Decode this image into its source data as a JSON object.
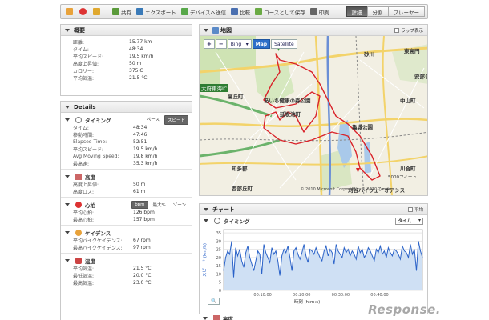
{
  "toolbar": {
    "share": "共有",
    "export": "エクスポート",
    "send_device": "デバイスへ送信",
    "compare": "比較",
    "save_course": "コースとして保存",
    "print": "印刷",
    "views": [
      "詳細",
      "分割",
      "プレーヤー"
    ],
    "active_view": "詳細"
  },
  "overview": {
    "title": "概要",
    "rows": [
      {
        "k": "距離:",
        "v": "15.77 km"
      },
      {
        "k": "タイム:",
        "v": "48:34"
      },
      {
        "k": "平均スピード:",
        "v": "19.5 km/h"
      },
      {
        "k": "高度上昇値:",
        "v": "50 m"
      },
      {
        "k": "カロリー:",
        "v": "375 C"
      },
      {
        "k": "平均気温:",
        "v": "21.5 °C"
      }
    ]
  },
  "details": {
    "title": "Details",
    "timing": {
      "title": "タイミング",
      "pills": [
        "ペース",
        "スピード"
      ],
      "rows": [
        {
          "k": "タイム:",
          "v": "48:34"
        },
        {
          "k": "移動時間:",
          "v": "47:46"
        },
        {
          "k": "Elapsed Time:",
          "v": "52:51"
        },
        {
          "k": "平均スピード:",
          "v": "19.5 km/h"
        },
        {
          "k": "Avg Moving Speed:",
          "v": "19.8 km/h"
        },
        {
          "k": "最高速:",
          "v": "35.3 km/h"
        }
      ]
    },
    "elevation": {
      "title": "高度",
      "rows": [
        {
          "k": "高度上昇値:",
          "v": "50 m"
        },
        {
          "k": "高度ロス:",
          "v": "61 m"
        }
      ]
    },
    "heart": {
      "title": "心拍",
      "pills": [
        "bpm",
        "最大%",
        "ゾーン"
      ],
      "rows": [
        {
          "k": "平均心拍:",
          "v": "126 bpm"
        },
        {
          "k": "最高心拍:",
          "v": "157 bpm"
        }
      ]
    },
    "cadence": {
      "title": "ケイデンス",
      "rows": [
        {
          "k": "平均バイクケイデンス:",
          "v": "67 rpm"
        },
        {
          "k": "最高バイクケイデンス:",
          "v": "97 rpm"
        }
      ]
    },
    "temperature": {
      "title": "温度",
      "rows": [
        {
          "k": "平均気温:",
          "v": "21.5 °C"
        },
        {
          "k": "最低気温:",
          "v": "20.0 °C"
        },
        {
          "k": "最高気温:",
          "v": "23.0 °C"
        }
      ]
    }
  },
  "map": {
    "title": "地図",
    "lap_toggle": "ラップ表示",
    "zoom_in": "+",
    "zoom_out": "−",
    "provider": "Bing",
    "map_type": "Map",
    "satellite": "Satellite",
    "copyright": "© 2010 Microsoft Corporation © 2010 Zenrin",
    "labels": [
      {
        "t": "砂川"
      },
      {
        "t": "東高円"
      },
      {
        "t": "安部台"
      },
      {
        "t": "高丘町"
      },
      {
        "t": "あいち健康の森公園"
      },
      {
        "t": "延坂池町"
      },
      {
        "t": "亀城公園"
      },
      {
        "t": "知多郡"
      },
      {
        "t": "西部丘町"
      },
      {
        "t": "川合町"
      },
      {
        "t": "刈谷ハイウェイオアシス"
      },
      {
        "t": "大府東海IC"
      },
      {
        "t": "中山町"
      },
      {
        "t": "5000フィート"
      }
    ]
  },
  "chart": {
    "title": "チャート",
    "avg_toggle": "平均",
    "sub_title": "タイミング",
    "selector": "タイム"
  },
  "chart_data": {
    "type": "area",
    "title": "",
    "xlabel": "時刻 (h:m:s)",
    "ylabel": "スピード (km/h)",
    "x_ticks": [
      "00:10:00",
      "00:20:00",
      "00:30:00",
      "00:40:00"
    ],
    "y_ticks": [
      "0",
      "5",
      "10",
      "15",
      "20",
      "25",
      "30",
      "35"
    ],
    "ylim": [
      0,
      37
    ],
    "series": [
      {
        "values": [
          12,
          20,
          24,
          22,
          30,
          8,
          26,
          21,
          25,
          18,
          14,
          23,
          27,
          20,
          16,
          12,
          18,
          24,
          22,
          10,
          28,
          23,
          20,
          17,
          26,
          22,
          24,
          18,
          9,
          21,
          25,
          23,
          27,
          20,
          12,
          24,
          26,
          22,
          19,
          23,
          28,
          21,
          17,
          25,
          24,
          22,
          26,
          23,
          20,
          18,
          24,
          27,
          21,
          25,
          23,
          16,
          28,
          24,
          22,
          20,
          26,
          23,
          25,
          21,
          24,
          22,
          19,
          27,
          23,
          25,
          20,
          22,
          26,
          24,
          21,
          18,
          25,
          23,
          27,
          22,
          24,
          20,
          26,
          23,
          21,
          25,
          24,
          22,
          19,
          27,
          24,
          23,
          20,
          28,
          22,
          25,
          12,
          30,
          24,
          20
        ]
      }
    ]
  },
  "next_section": {
    "title": "高度"
  },
  "watermark": "Response."
}
